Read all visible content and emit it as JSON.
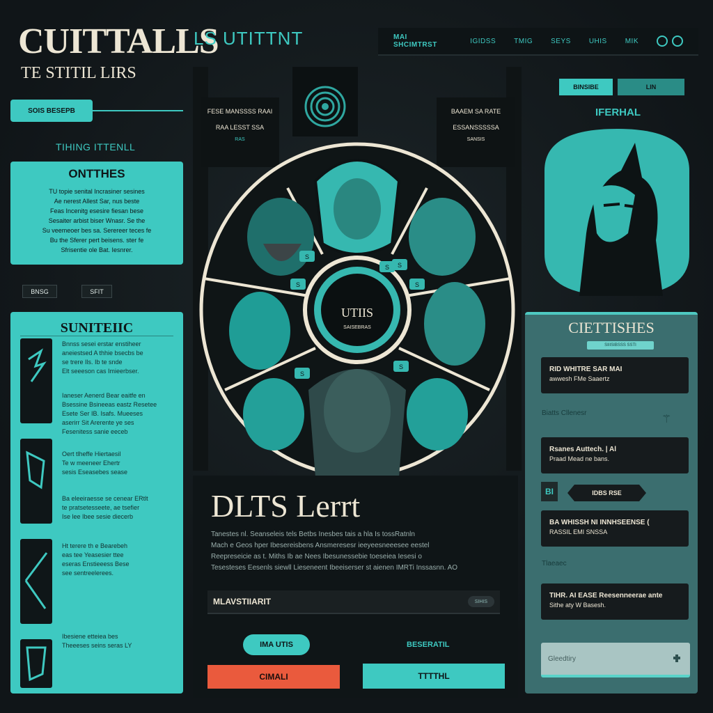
{
  "header": {
    "brand_title": "CUITTALLS",
    "brand_subtitle": "TE STITIL LIRS",
    "brand_tag": "LS UTITTNT",
    "nav_items": [
      "MAI SHCIMTRST",
      "IGIDSS",
      "TMIG",
      "SEYS",
      "UHIS",
      "MIK"
    ]
  },
  "left": {
    "pill_button": "SOIS BESEPB",
    "heading": "TIHING ITTENLL",
    "card1": {
      "title": "ONTTHES",
      "body": [
        "TU topie senital Incrasiner sesines",
        "Ae nerest Allest Sar, nus beste",
        "Feas Incenitg esesire fiesan bese",
        "Sesaiter arbist biser Wnasr. Se the",
        "Su veemeoer bes sa. Serereer teces fe",
        "Bu the Sferer pert beisens. ster fe",
        "Sfrisentie ole Bat. Iesnrer."
      ]
    },
    "tag_left": "BNSG",
    "tag_right": "SFIT",
    "card2": {
      "title": "SUNITEIIC",
      "entries": [
        [
          "Bnnss sesei erstar enstiheer",
          "aneiestsed A thhie bsecbs be",
          "se trere Ils. Ib te snde",
          "Elt seeeson cas Imieerbser."
        ],
        [
          "Ianeser Aenerd Bear eaitfe en",
          "Bsessine Bsineeas eastz Resetee",
          "Esete Ser IB. Isafs. Mueeses",
          "aserirr Sit Arerente ye ses",
          "Fesenitess sanie eeceb"
        ],
        [
          "Oert tlheffe Hiertaesil",
          "Te w meeneer Ehertr",
          "sesis Eseasebes sease"
        ],
        [
          "Ba eleeiraesse se cenear ERtlt",
          "te pratsetesseete, ae tsefier",
          "Ise lee Ibee sesie diecerb"
        ],
        [
          "Ht terere th e Bearebeh",
          "eas tee Yeasesier ttee",
          "eseras Enstieeess Bese",
          "see sentreelerees."
        ],
        [
          "Ibesiene etteiea bes",
          "Theeeses seins seras LY"
        ]
      ]
    }
  },
  "center": {
    "banner_left": [
      "FESE MANSSSS RAAI",
      "RAA LESST SSA",
      "RAS"
    ],
    "banner_right": [
      "BAAEM SA RATE",
      "ESSANSSSSSA",
      "SANSIS"
    ],
    "wheel_center_title": "UTIIS",
    "wheel_center_sub": "SAISEBRAS",
    "wheel_badges": [
      "S",
      "S",
      "S",
      "S",
      "S",
      "S",
      "S"
    ],
    "panel_title": "DLTS Lerrt",
    "panel_body": [
      "Tanestes nl. Seanseleis tels Betbs Inesbes tais a hla Is tossRatnln",
      "Mach e Geos hper Ibesereisbens Ansmeresesr ieeyeesneeesee eestel",
      "Reepreseicie as t. Miths Ib ae Nees Ibesunessebie toeseiea Iesesi o",
      "Tesesteses Eesenls siewll Lieseneent Ibeeiserser st aienen IMRTi Inssasnn. AO"
    ],
    "bar_label": "MLAVSTIIARIT",
    "bar_chip": "SIHIS",
    "pill_button": "IMA UTIS",
    "link": "BESERATIL",
    "btn_orange": "CIMALI",
    "btn_teal": "TTTTHL"
  },
  "right": {
    "btn_left": "BINSIBE",
    "btn_right": "LIN",
    "heading": "IFERHAL",
    "panel_title": "CIETTISHES",
    "panel_chip": "SIIISIBSSS SSTI",
    "cards": [
      {
        "line1": "RID WHITRE SAR MAI",
        "line2": "awwesh FMe Saaertz"
      },
      {
        "line1": "Rsanes Auttech. | Al",
        "line2": "Praad Mead ne bans."
      },
      {
        "line1": "BA WHISSH NI INNHSEENSE (",
        "line2": "RASSIL EMI SNSSA"
      },
      {
        "line1": "TIHR. AI EASE Reesenneerae ante",
        "line2": "Sithe aty W Basesh."
      }
    ],
    "label1": "Biatts Cllenesr",
    "label2": "Tlaeaec",
    "mini_button": "BI",
    "arrow_chip": "IDBS RSE",
    "input_placeholder": "Gleedtiry"
  }
}
